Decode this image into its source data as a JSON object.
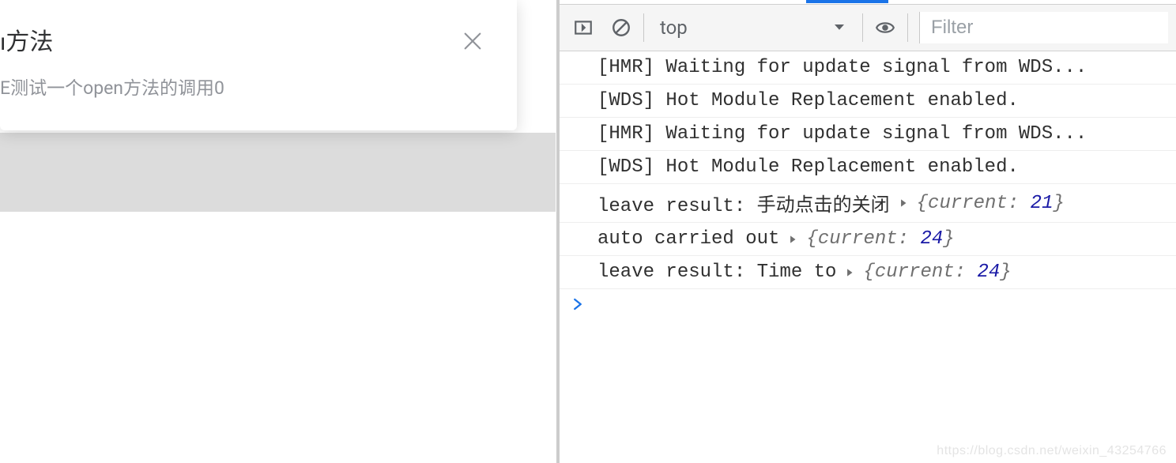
{
  "modal": {
    "title": "ı方法",
    "body": "E测试一个open方法的调用0"
  },
  "toolbar": {
    "context": "top",
    "filter_placeholder": "Filter"
  },
  "console": {
    "rows": [
      {
        "text": "[HMR] Waiting for update signal from WDS...",
        "obj": null
      },
      {
        "text": "[WDS] Hot Module Replacement enabled.",
        "obj": null
      },
      {
        "text": "[HMR] Waiting for update signal from WDS...",
        "obj": null
      },
      {
        "text": "[WDS] Hot Module Replacement enabled.",
        "obj": null
      },
      {
        "text": "leave result: 手动点击的关闭",
        "obj": {
          "key": "current",
          "value": 21
        }
      },
      {
        "text": "auto carried out",
        "obj": {
          "key": "current",
          "value": 24
        }
      },
      {
        "text": "leave result: Time to",
        "obj": {
          "key": "current",
          "value": 24
        }
      }
    ]
  },
  "watermark": "https://blog.csdn.net/weixin_43254766"
}
